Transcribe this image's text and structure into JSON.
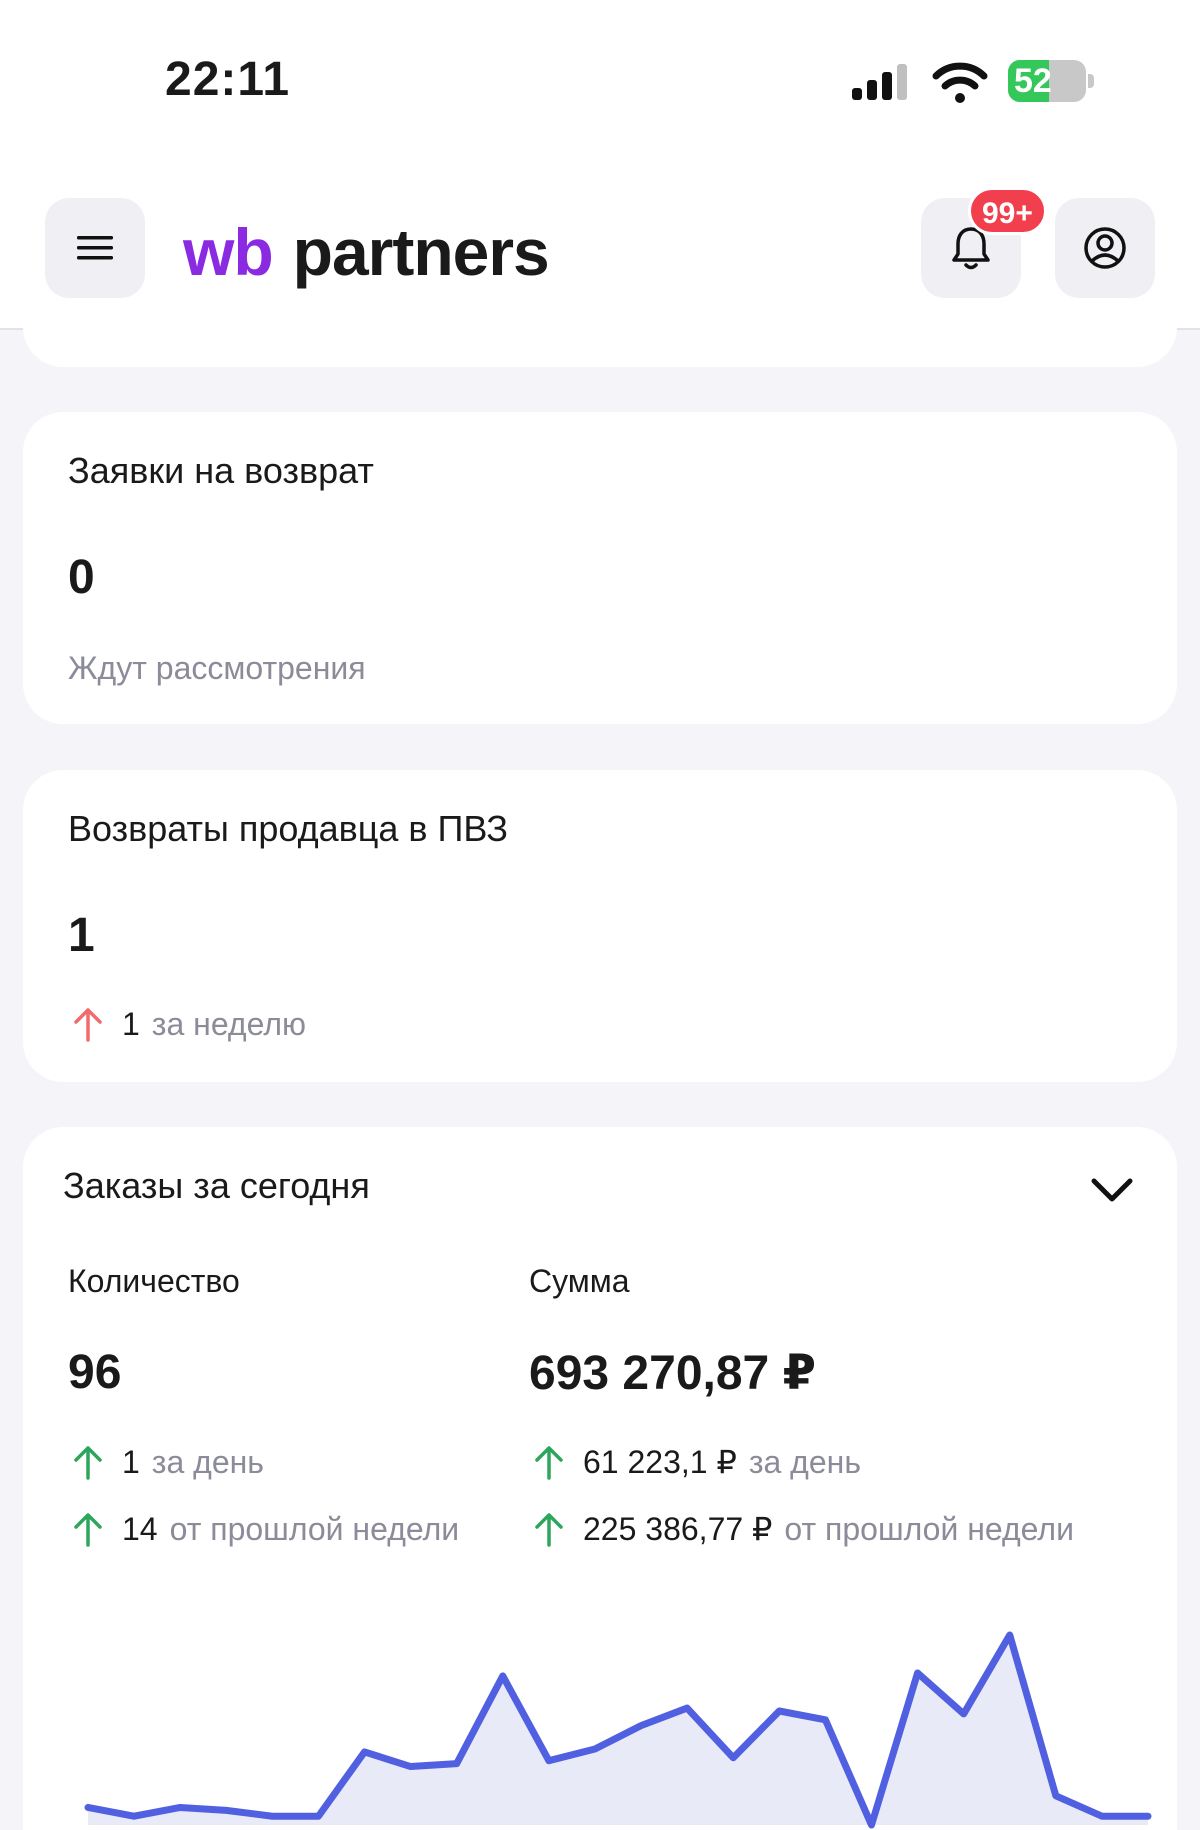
{
  "status_bar": {
    "time": "22:11",
    "battery": "52",
    "battery_level": 0.52
  },
  "header": {
    "logo_wb": "wb",
    "logo_rest": "partners",
    "notifications_badge": "99+"
  },
  "returns_card": {
    "title": "Заявки на возврат",
    "value": "0",
    "subtitle": "Ждут рассмотрения"
  },
  "seller_returns_card": {
    "title": "Возвраты продавца в ПВЗ",
    "value": "1",
    "trend_value": "1",
    "trend_text": "за неделю",
    "trend_color": "#f06b6b"
  },
  "orders_card": {
    "title": "Заказы за сегодня",
    "count_label": "Количество",
    "count_value": "96",
    "count_day_value": "1",
    "count_day_text": "за день",
    "count_week_value": "14",
    "count_week_text": "от прошлой недели",
    "sum_label": "Сумма",
    "sum_value": "693 270,87 ₽",
    "sum_day_value": "61 223,1 ₽",
    "sum_day_text": "за день",
    "sum_week_value": "225 386,77 ₽",
    "sum_week_text": "от прошлой недели",
    "trend_color": "#2da55c"
  },
  "chart_data": {
    "type": "area",
    "color": "#5060e0",
    "fill_color": "#e8eaf8",
    "values": [
      6,
      3,
      6,
      5,
      3,
      3,
      25,
      20,
      21,
      51,
      22,
      26,
      34,
      40,
      23,
      39,
      36,
      0,
      52,
      38,
      65,
      10,
      3,
      3
    ]
  }
}
